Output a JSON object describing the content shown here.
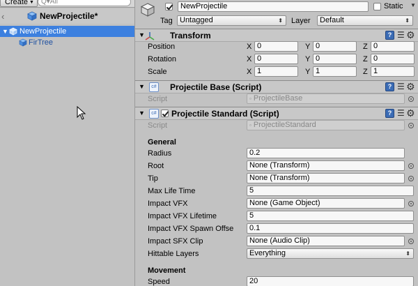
{
  "hierarchy": {
    "create_label": "Create",
    "search_placeholder": "Q▾All",
    "scene_title": "NewProjectile*",
    "items": [
      {
        "label": "NewProjectile"
      },
      {
        "label": "FirTree"
      }
    ]
  },
  "inspector": {
    "object_name": "NewProjectile",
    "static_label": "Static",
    "tag_label": "Tag",
    "tag_value": "Untagged",
    "layer_label": "Layer",
    "layer_value": "Default",
    "transform": {
      "title": "Transform",
      "position_label": "Position",
      "rotation_label": "Rotation",
      "scale_label": "Scale",
      "axis_x": "X",
      "axis_y": "Y",
      "axis_z": "Z",
      "position": {
        "x": "0",
        "y": "0",
        "z": "0"
      },
      "rotation": {
        "x": "0",
        "y": "0",
        "z": "0"
      },
      "scale": {
        "x": "1",
        "y": "1",
        "z": "1"
      }
    },
    "projectile_base": {
      "title": "Projectile Base (Script)",
      "script_label": "Script",
      "script_value": "ProjectileBase"
    },
    "projectile_standard": {
      "title": "Projectile Standard (Script)",
      "script_label": "Script",
      "script_value": "ProjectileStandard",
      "general_header": "General",
      "fields": [
        {
          "label": "Radius",
          "value": "0.2"
        },
        {
          "label": "Root",
          "value": "None (Transform)"
        },
        {
          "label": "Tip",
          "value": "None (Transform)"
        },
        {
          "label": "Max Life Time",
          "value": "5"
        },
        {
          "label": "Impact VFX",
          "value": "None (Game Object)"
        },
        {
          "label": "Impact VFX Lifetime",
          "value": "5"
        },
        {
          "label": "Impact VFX Spawn Offse",
          "value": "0.1"
        },
        {
          "label": "Impact SFX Clip",
          "value": "None (Audio Clip)"
        },
        {
          "label": "Hittable Layers",
          "value": "Everything"
        }
      ],
      "movement_header": "Movement",
      "speed_label": "Speed",
      "speed_value": "20"
    },
    "icon_names": [
      "book-icon",
      "menu-icon",
      "gear-icon",
      "object-picker-icon"
    ],
    "colors": {
      "selection": "#3d80df",
      "panel": "#c2c2c2",
      "field": "#f7f7f7"
    }
  }
}
